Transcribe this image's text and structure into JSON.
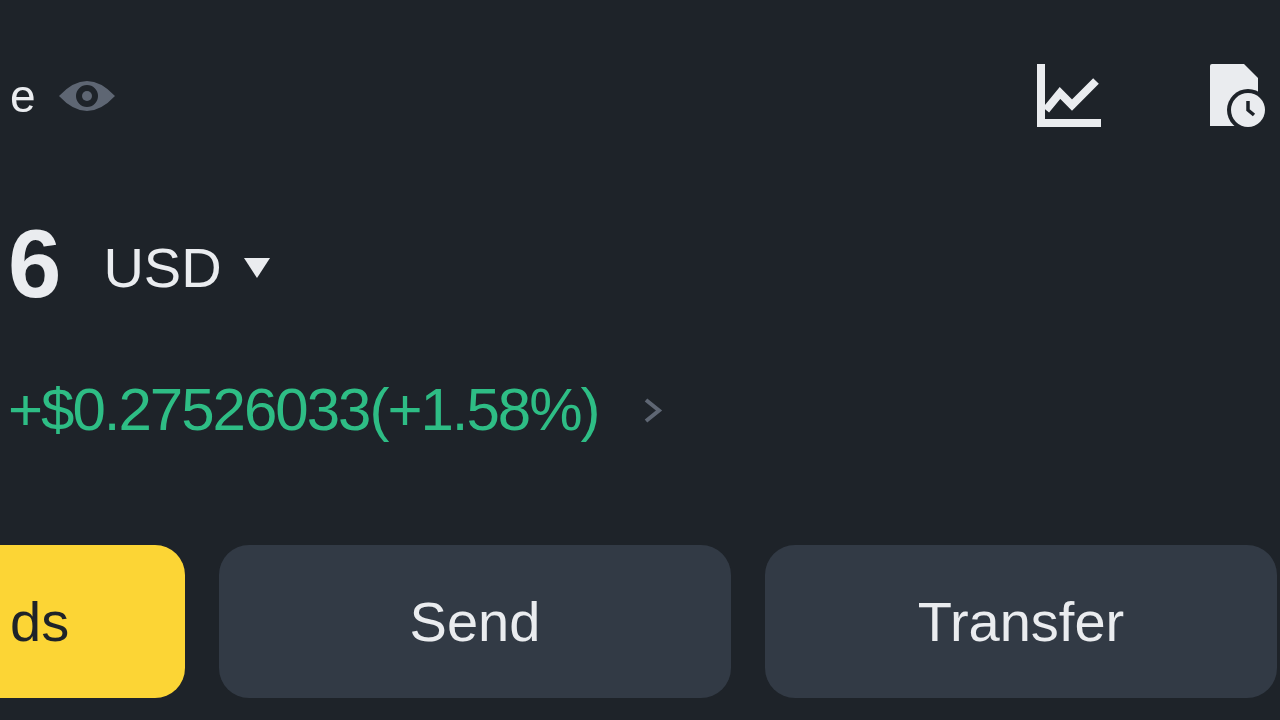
{
  "balance": {
    "label": "e",
    "amount": "6",
    "currency": "USD",
    "change": "+$0.27526033(+1.58%)"
  },
  "actions": [
    {
      "label": "ds",
      "kind": "primary"
    },
    {
      "label": "Send",
      "kind": "secondary"
    },
    {
      "label": "Transfer",
      "kind": "secondary"
    }
  ]
}
